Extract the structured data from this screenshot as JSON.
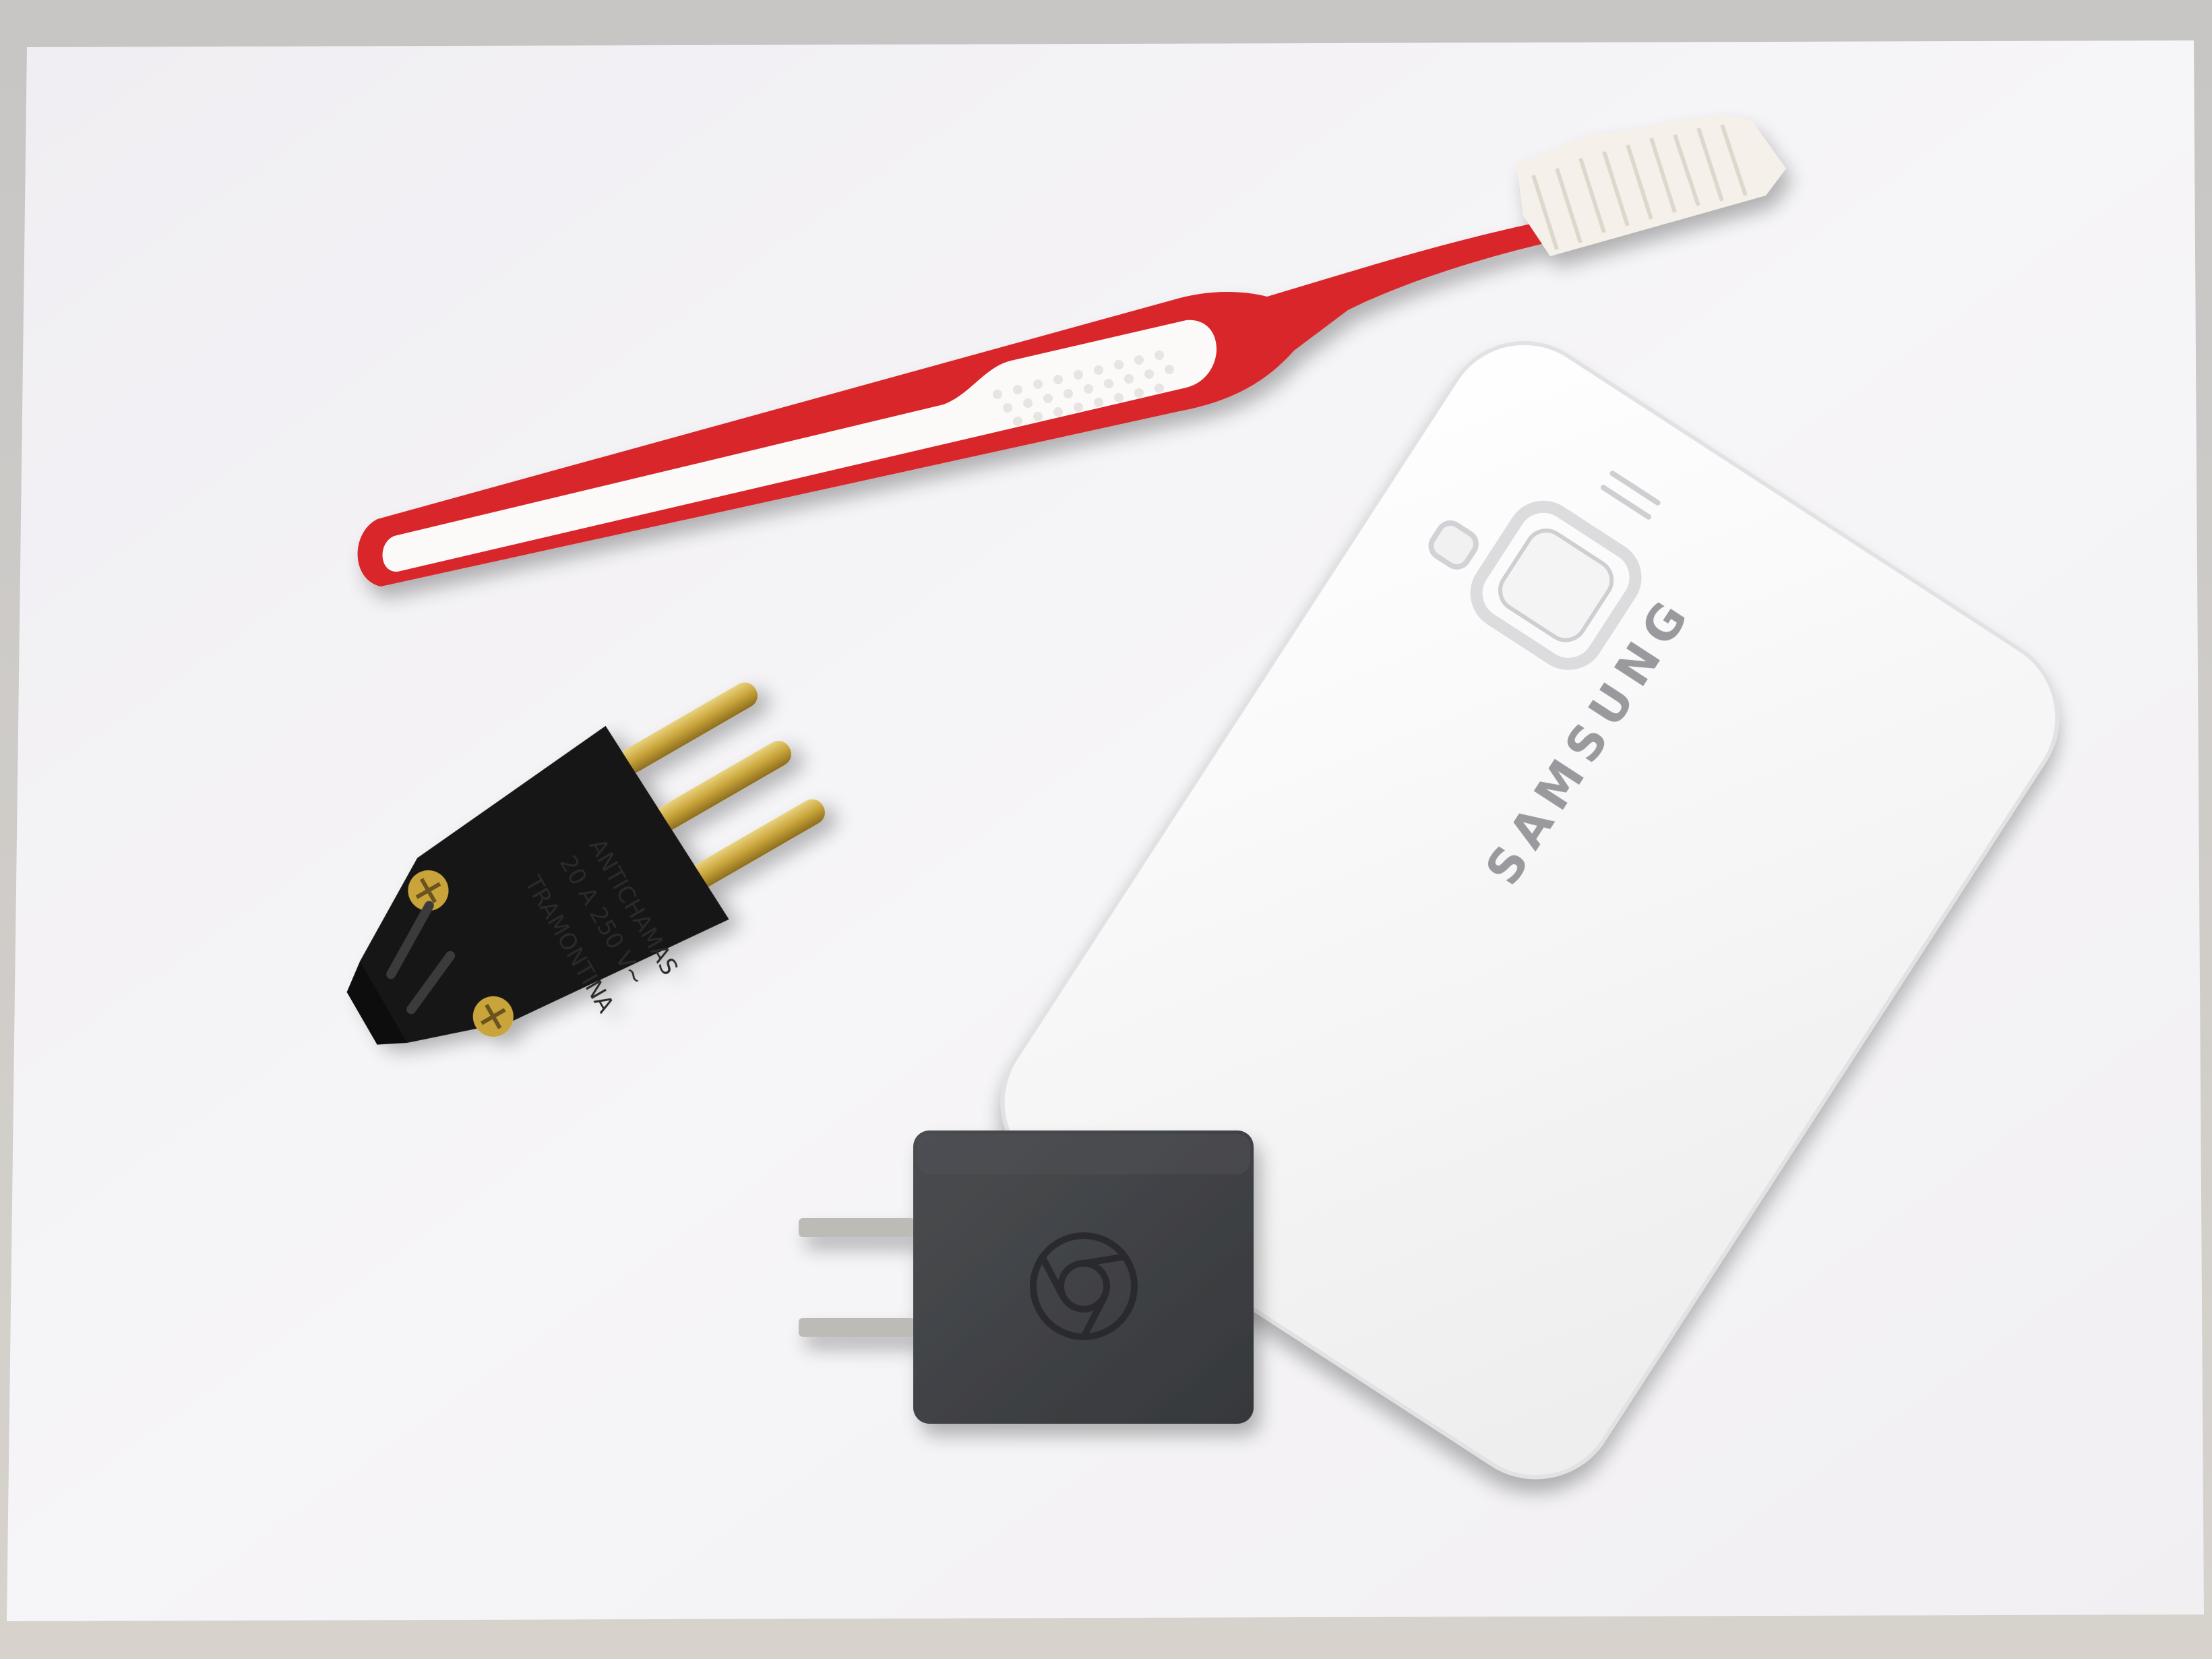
{
  "scene": {
    "description_kind": "photograph",
    "background_color": "#cfcbc6",
    "paper_color": "#f3f2f4"
  },
  "objects": {
    "toothbrush": {
      "handle_color": "#d8262b",
      "grip_color": "#fbfaf9",
      "bristle_color": "#f5f1ea"
    },
    "phone_back_cover": {
      "color": "#f7f7f7",
      "brand_text": "SAMSUNG",
      "brand_text_color": "#9a9a9e"
    },
    "brazilian_plug": {
      "body_color": "#151515",
      "pin_color": "#c9a43a",
      "label_lines": [
        "TRAMONTINA",
        "20 A 250 V~",
        "ANTICHAMAS"
      ]
    },
    "usb_charger": {
      "body_color": "#3f4144",
      "prong_color": "#bdbbb6",
      "logo": "chrome-logo-icon"
    }
  }
}
